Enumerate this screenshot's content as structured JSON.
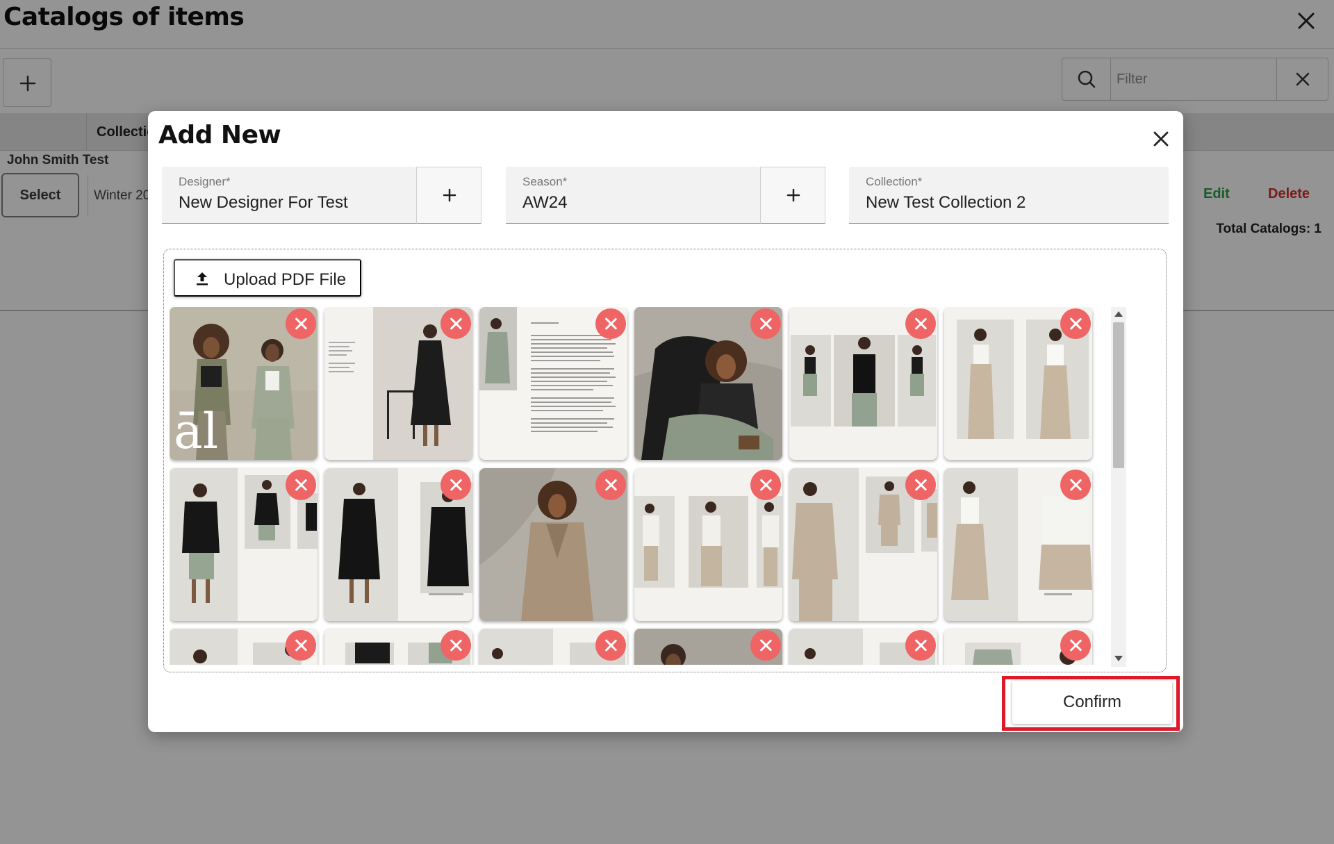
{
  "page": {
    "title": "Catalogs of items",
    "filter_placeholder": "Filter",
    "table": {
      "column_collection": "Collectio",
      "owner": "John Smith Test",
      "row": {
        "select_label": "Select",
        "season_snippet": "Winter 20",
        "edit_label": "Edit",
        "delete_label": "Delete"
      },
      "total_label": "Total Catalogs: 1"
    }
  },
  "dialog": {
    "title": "Add New",
    "fields": {
      "designer": {
        "label": "Designer*",
        "value": "New Designer For Test"
      },
      "season": {
        "label": "Season*",
        "value": "AW24"
      },
      "collection": {
        "label": "Collection*",
        "value": "New Test Collection 2"
      }
    },
    "upload_label": "Upload PDF File",
    "confirm_label": "Confirm",
    "overlay_text": "āl",
    "pages": [
      "cover",
      "black-dress-chair",
      "text-spread",
      "armchair-portrait",
      "black-tank-shorts",
      "white-top-beige-pants",
      "black-shirt-shorts",
      "black-shirt-dress",
      "beige-suit",
      "white-shirt-beige-pants",
      "beige-blazer",
      "white-top-wide-pants",
      "page-13",
      "page-14",
      "page-15",
      "page-16",
      "page-17",
      "page-18"
    ]
  },
  "colors": {
    "accent_delete": "#d32f2f",
    "accent_edit": "#2e9c45",
    "remove_badge": "#ef6464",
    "highlight": "#e0192a"
  }
}
